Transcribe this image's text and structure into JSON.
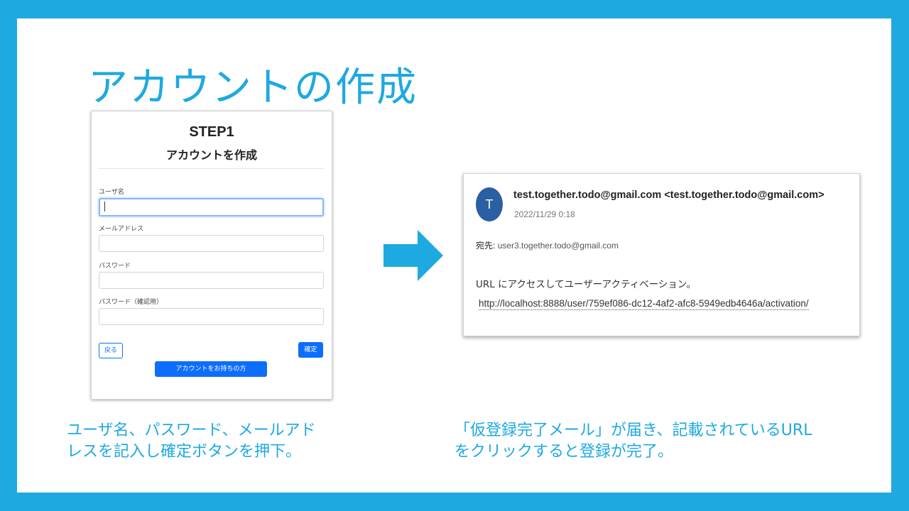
{
  "slide": {
    "title": "アカウントの作成"
  },
  "signup_form": {
    "step": "STEP1",
    "heading": "アカウントを作成",
    "fields": [
      {
        "label": "ユーザ名",
        "value": "",
        "focused": true
      },
      {
        "label": "メールアドレス",
        "value": ""
      },
      {
        "label": "パスワード",
        "value": ""
      },
      {
        "label": "パスワード（確認用）",
        "value": ""
      }
    ],
    "back_button": "戻る",
    "confirm_button": "確定",
    "have_account_button": "アカウントをお持ちの方"
  },
  "arrow": {
    "icon": "right-arrow-icon",
    "color": "#1ea9e1"
  },
  "email": {
    "avatar_letter": "T",
    "avatar_color": "#2b5fa3",
    "sender": "test.together.todo@gmail.com <test.together.todo@gmail.com>",
    "date": "2022/11/29 0:18",
    "to_label": "宛先:",
    "to_address": "user3.together.todo@gmail.com",
    "body": "URL にアクセスしてユーザーアクティベーション。",
    "link": "http://localhost:8888/user/759ef086-dc12-4af2-afc8-5949edb4646a/activation/"
  },
  "captions": {
    "left_line1": "ユーザ名、パスワード、メールアド",
    "left_line2": "レスを記入し確定ボタンを押下。",
    "right_line1": "「仮登録完了メール」が届き、記載されているURL",
    "right_line2": "をクリックすると登録が完了。"
  },
  "colors": {
    "frame": "#1ea9e1",
    "primary_button": "#0d6efd"
  }
}
